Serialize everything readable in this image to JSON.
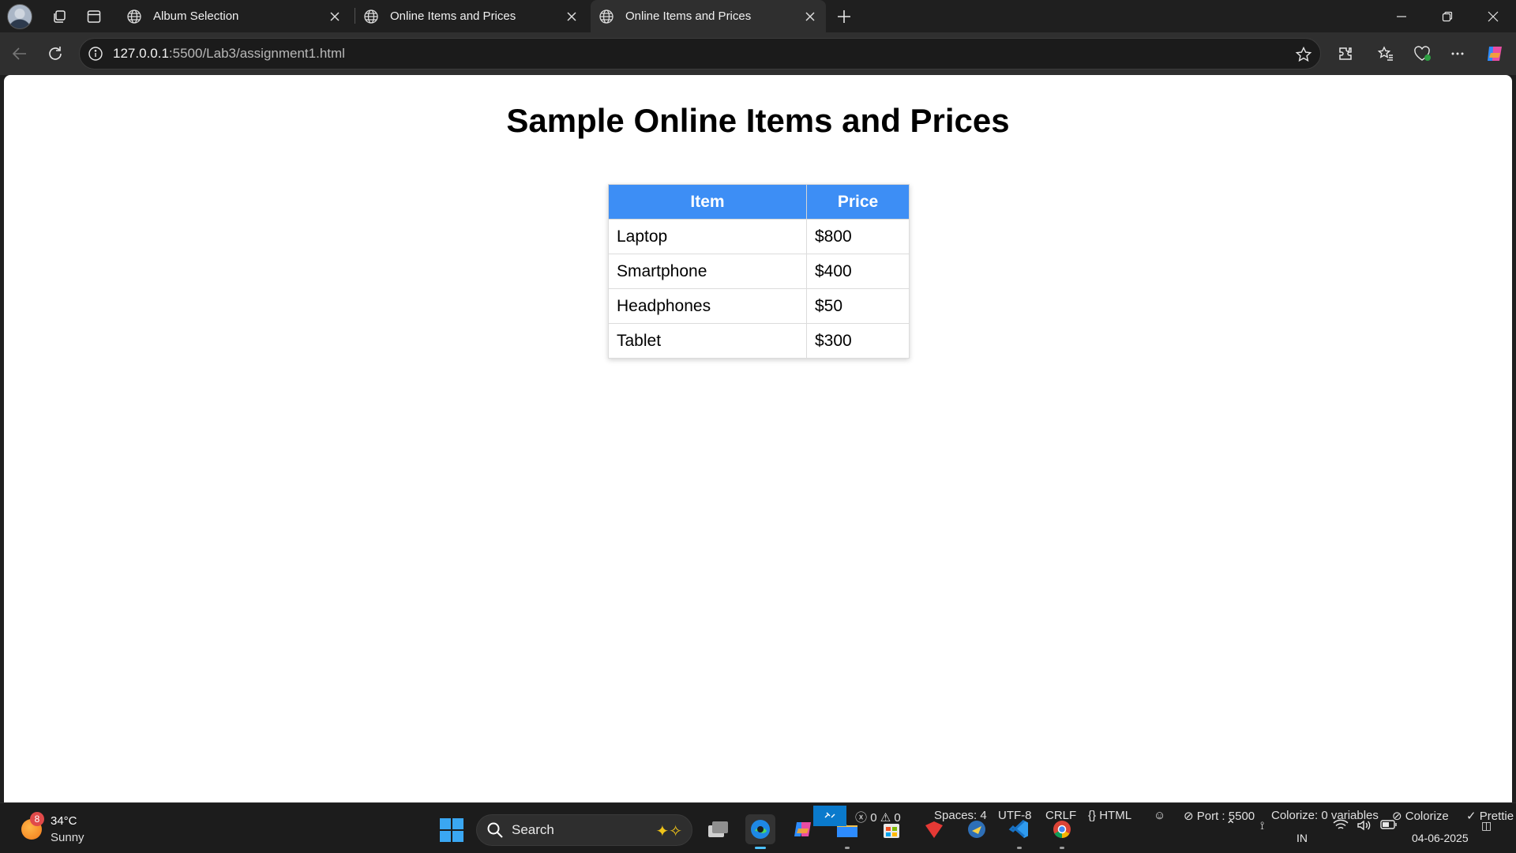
{
  "browser": {
    "tabs": [
      {
        "label": "Album Selection",
        "active": false
      },
      {
        "label": "Online Items and Prices",
        "active": false
      },
      {
        "label": "Online Items and Prices",
        "active": true
      }
    ],
    "url_host": "127.0.0.1",
    "url_rest": ":5500/Lab3/assignment1.html"
  },
  "page": {
    "title": "Sample Online Items and Prices",
    "table": {
      "headers": [
        "Item",
        "Price"
      ],
      "rows": [
        [
          "Laptop",
          "$800"
        ],
        [
          "Smartphone",
          "$400"
        ],
        [
          "Headphones",
          "$50"
        ],
        [
          "Tablet",
          "$300"
        ]
      ],
      "header_color": "#3d8ef5"
    }
  },
  "taskbar": {
    "weather_badge": "8",
    "weather_temp": "34°C",
    "weather_cond": "Sunny",
    "search_label": "Search",
    "lang": "IN",
    "date": "04-06-2025"
  },
  "statusbar": {
    "errors": "0",
    "warnings": "0",
    "spaces": "Spaces: 4",
    "encoding": "UTF-8",
    "eol": "CRLF",
    "language": "HTML",
    "port": "Port : 5500",
    "colorize_vars": "Colorize: 0 variables",
    "colorize": "Colorize",
    "prettier": "Prettie"
  }
}
